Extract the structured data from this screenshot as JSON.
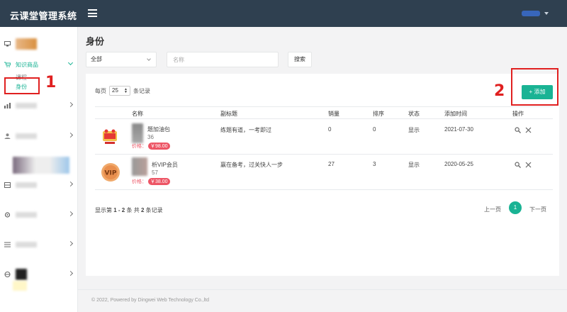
{
  "app": {
    "title": "云课堂管理系统"
  },
  "sidebar": {
    "items": [
      {
        "label": "",
        "icon": "monitor-icon"
      },
      {
        "label": "知识商品",
        "icon": "cart-icon",
        "expanded": true,
        "children": [
          {
            "label": "课程"
          },
          {
            "label": "身份",
            "active": true
          }
        ]
      },
      {
        "label": "",
        "icon": "chart-icon"
      },
      {
        "label": "",
        "icon": "user-icon"
      },
      {
        "label": "",
        "icon": "grid-icon"
      },
      {
        "label": "",
        "icon": "settings-icon"
      },
      {
        "label": "",
        "icon": "list-icon"
      },
      {
        "label": "",
        "icon": "globe-icon"
      }
    ]
  },
  "annotations": {
    "one": "1",
    "two": "2"
  },
  "page": {
    "title": "身份",
    "filter": {
      "selected": "全部"
    },
    "search": {
      "placeholder": "名称",
      "button": "搜索"
    }
  },
  "panel": {
    "perpage_prefix": "每页",
    "perpage_value": "25",
    "perpage_suffix": "条记录",
    "add_button": "+ 添加"
  },
  "table": {
    "headers": [
      "名称",
      "副标题",
      "销量",
      "排序",
      "状态",
      "添加时间",
      "操作"
    ],
    "rows": [
      {
        "name_top": "题加油包",
        "name_mid": "36",
        "price_label": "价格：",
        "price": "￥98.00",
        "subtitle": "练题有道，一考即过",
        "sales": "0",
        "sort": "0",
        "status": "显示",
        "date": "2021-07-30"
      },
      {
        "name_top": "析VIP会员",
        "name_mid": "57",
        "price_label": "价格：",
        "price": "￥38.00",
        "subtitle": "赢在备考，过关快人一步",
        "sales": "27",
        "sort": "3",
        "status": "显示",
        "date": "2020-05-25"
      }
    ]
  },
  "pagination": {
    "info_prefix": "显示第",
    "info_range": "1 - 2",
    "info_mid": "条   共",
    "info_total": "2",
    "info_suffix": "条记录",
    "prev": "上一页",
    "current": "1",
    "next": "下一页"
  },
  "footer": {
    "text": "© 2022, Powered by Dingwei Web Technology Co.,ltd"
  },
  "colors": {
    "accent": "#1ab394",
    "topbar": "#2f4050",
    "price": "#ed5565",
    "annotation": "#e02020"
  }
}
